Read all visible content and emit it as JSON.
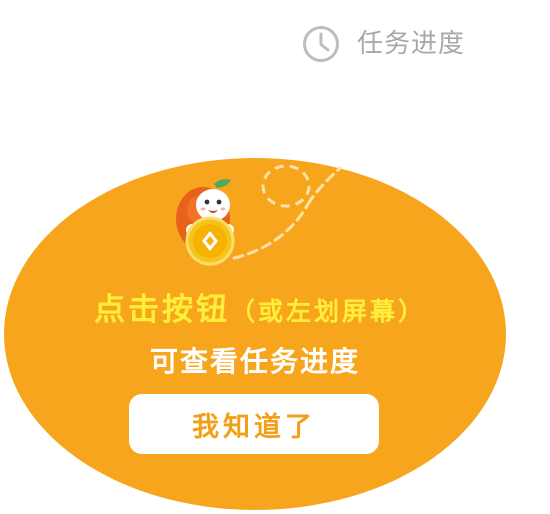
{
  "header": {
    "progress_label": "任务进度",
    "progress_icon": "clock-icon"
  },
  "guide": {
    "instruction_main": "点击按钮",
    "instruction_paren": "（或左划屏幕）",
    "instruction_sub": "可查看任务进度",
    "confirm_label": "我知道了",
    "mascot_icon": "orange-mascot-holding-coin",
    "coin_icon": "coin-icon"
  },
  "colors": {
    "bubble": "#f7a51c",
    "highlight_text": "#ffef3a",
    "button_text": "#f2a018",
    "muted_text": "#a8a8a8"
  }
}
